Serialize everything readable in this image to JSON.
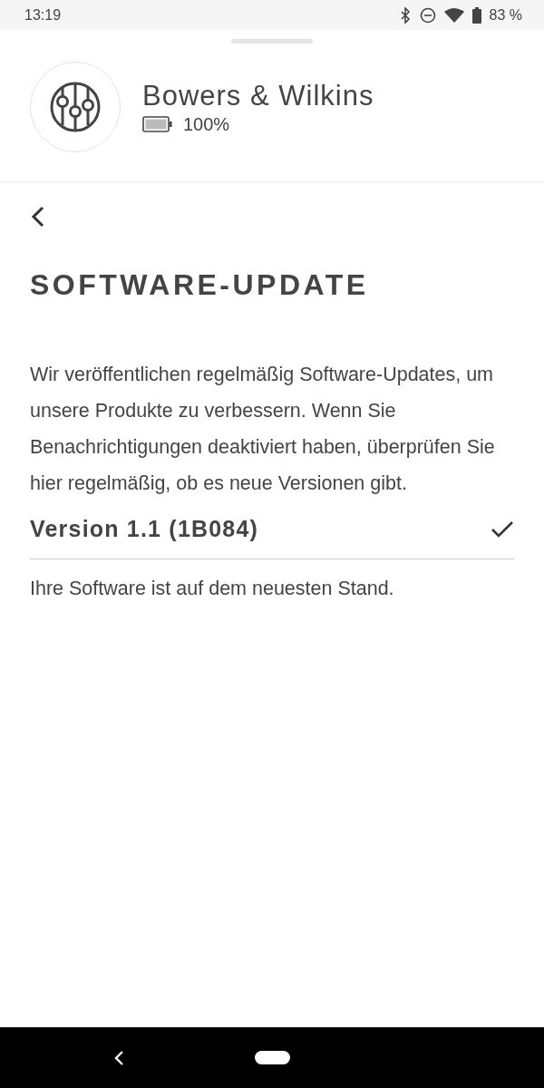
{
  "status_bar": {
    "time": "13:19",
    "battery": "83 %"
  },
  "device": {
    "name": "Bowers & Wilkins",
    "battery": "100%"
  },
  "page": {
    "title": "SOFTWARE-UPDATE",
    "description": "Wir veröffentlichen regelmäßig Software-Updates, um unsere Produkte zu verbessern. Wenn Sie Benachrichtigungen deaktiviert haben, überprüfen Sie hier regelmäßig, ob es neue Versionen gibt.",
    "version": {
      "label": "Version 1.1 (1B084)",
      "checked": true
    },
    "status": "Ihre Software ist auf dem neuesten Stand."
  }
}
